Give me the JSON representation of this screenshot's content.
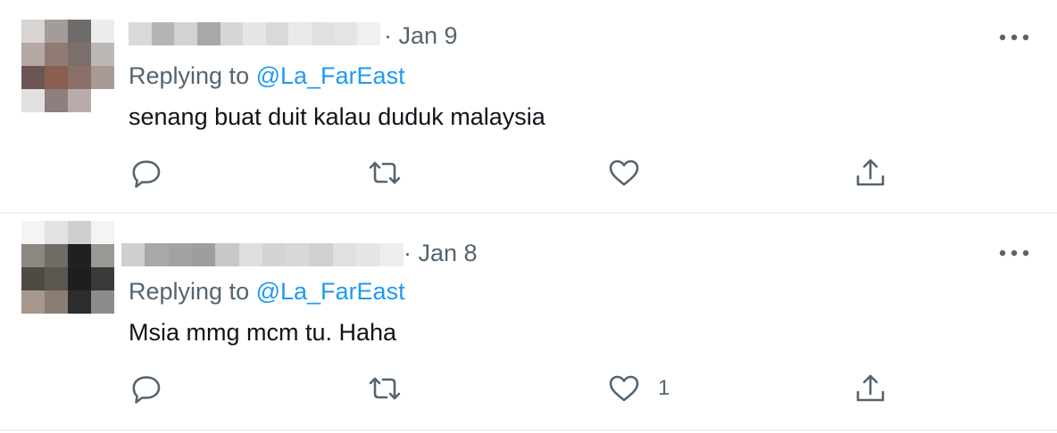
{
  "tweets": [
    {
      "date": "· Jan 9",
      "replying_prefix": "Replying to ",
      "replying_handle": "@La_FarEast",
      "text": "senang buat duit kalau duduk malaysia",
      "like_count": ""
    },
    {
      "date": "· Jan 8",
      "replying_prefix": "Replying to ",
      "replying_handle": "@La_FarEast",
      "text": "Msia mmg mcm tu. Haha",
      "like_count": "1"
    }
  ],
  "icons": {
    "more": "more-horizontal-icon",
    "reply": "reply-icon",
    "retweet": "retweet-icon",
    "like": "heart-icon",
    "share": "share-icon"
  },
  "colors": {
    "text": "#0f1419",
    "secondary": "#536471",
    "link": "#1d9bf0",
    "divider": "#eff3f4"
  }
}
